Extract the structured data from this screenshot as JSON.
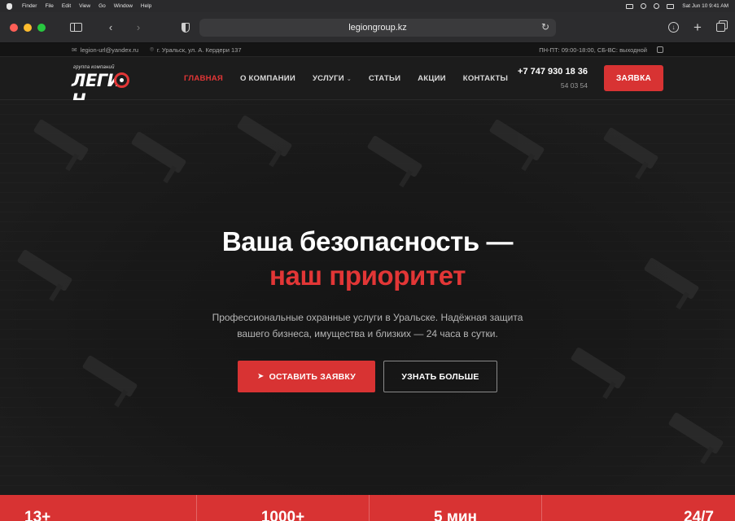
{
  "menubar": {
    "app": "Finder",
    "items": [
      "File",
      "Edit",
      "View",
      "Go",
      "Window",
      "Help"
    ],
    "clock": "Sat Jun 10  9:41 AM"
  },
  "browser": {
    "url": "legiongroup.kz"
  },
  "infobar": {
    "email": "legion-url@yandex.ru",
    "address": "г. Уральск, ул. А. Кердери 137",
    "hours": "ПН-ПТ: 09:00-18:00, СБ-ВС: выходной"
  },
  "header": {
    "logo_sub": "группа компаний",
    "logo_text": "ЛЕГИ",
    "logo_text_end": "Н",
    "nav": [
      {
        "label": "ГЛАВНАЯ",
        "active": true
      },
      {
        "label": "О КОМПАНИИ"
      },
      {
        "label": "УСЛУГИ",
        "dropdown": true
      },
      {
        "label": "СТАТЬИ"
      },
      {
        "label": "АКЦИИ"
      },
      {
        "label": "КОНТАКТЫ"
      }
    ],
    "phone_main": "+7 747 930 18 36",
    "phone_alt": "54 03 54",
    "cta": "ЗАЯВКА"
  },
  "hero": {
    "title": "Ваша безопасность —",
    "accent": "наш приоритет",
    "subtitle": "Профессиональные охранные услуги в Уральске. Надёжная защита вашего бизнеса, имущества и близких — 24 часа в сутки.",
    "primary_button": "ОСТАВИТЬ ЗАЯВКУ",
    "secondary_button": "УЗНАТЬ БОЛЬШЕ"
  },
  "stats": [
    "13+",
    "1000+",
    "5 мин",
    "24/7"
  ],
  "colors": {
    "accent": "#d83333",
    "background": "#1b1b1d"
  }
}
